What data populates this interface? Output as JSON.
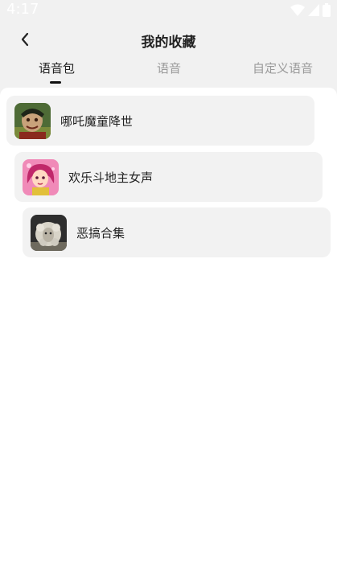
{
  "status_bar": {
    "time": "4:17",
    "icons": [
      "wifi-icon",
      "signal-icon",
      "battery-icon"
    ]
  },
  "header": {
    "back_icon": "chevron-left-icon",
    "title": "我的收藏"
  },
  "tabs": [
    {
      "label": "语音包",
      "active": true
    },
    {
      "label": "语音",
      "active": false
    },
    {
      "label": "自定义语音",
      "active": false
    }
  ],
  "items": [
    {
      "label": "哪吒魔童降世",
      "thumbnail": "nezha-thumbnail"
    },
    {
      "label": "欢乐斗地主女声",
      "thumbnail": "doudizhu-girl-thumbnail"
    },
    {
      "label": "恶搞合集",
      "thumbnail": "sheep-thumbnail"
    }
  ],
  "colors": {
    "background": "#f1f1f1",
    "card": "#f2f2f2",
    "text": "#222222",
    "tab_inactive": "#9a9a9a"
  }
}
